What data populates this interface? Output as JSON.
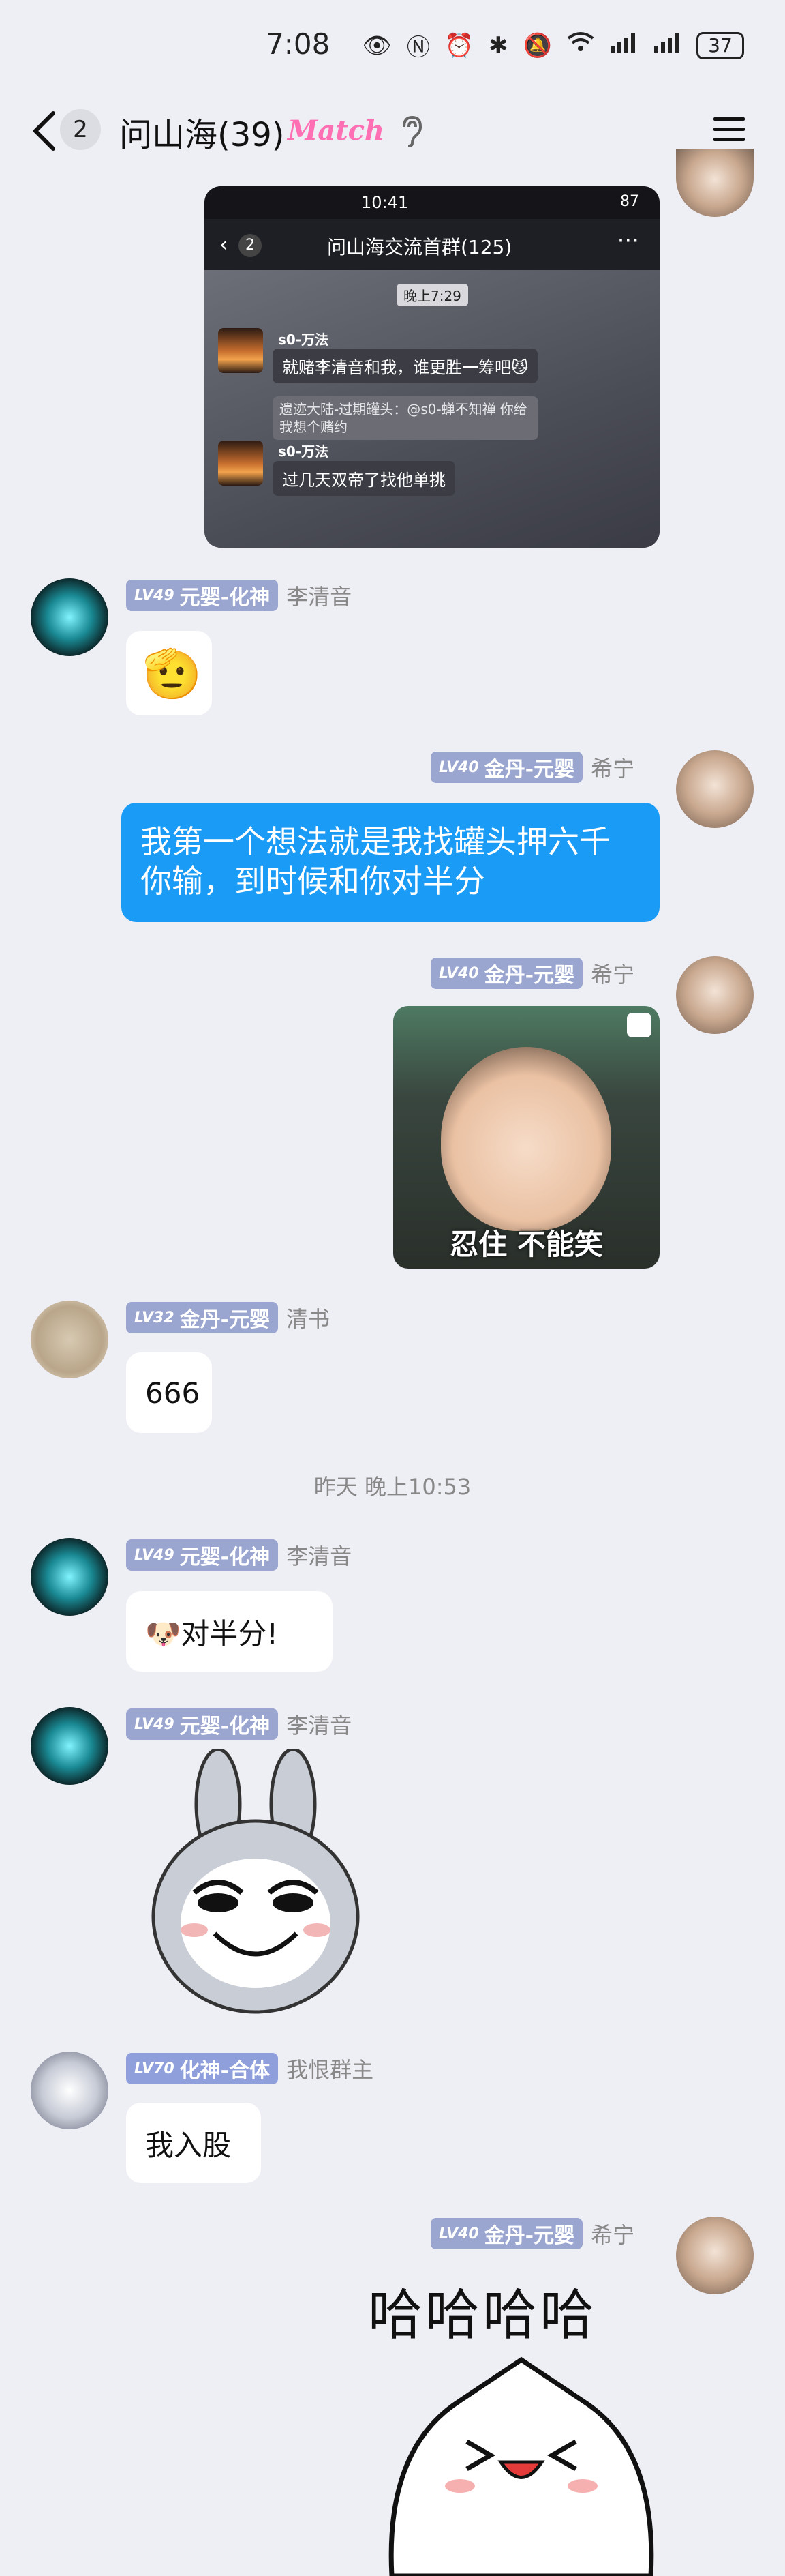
{
  "status_bar": {
    "time": "7:08",
    "icons": [
      "eye-icon",
      "nfc-icon",
      "alarm-icon",
      "bluetooth-icon",
      "mute-icon",
      "wifi-icon",
      "signal-4g-icon",
      "signal-5g-icon"
    ],
    "battery": "37"
  },
  "nav": {
    "unread_count": "2",
    "title": "问山海(39)",
    "match_label": "Match"
  },
  "quoted_screenshot": {
    "time": "10:41",
    "battery": "87",
    "unread_count": "2",
    "group_title": "问山海交流首群(125)",
    "timestamp": "晚上7:29",
    "msg1_name": "s0-万法",
    "msg1_text": "就赌李清音和我，谁更胜一筹吧😼",
    "msg2_quote": "遗迹大陆-过期罐头：@s0-蝉不知禅 你给我想个赌约",
    "msg3_name": "s0-万法",
    "msg3_text": "过几天双帝了找他单挑"
  },
  "messages": [
    {
      "level": "LV49",
      "rank": "元婴-化神",
      "name": "李清音",
      "type": "emoji",
      "content": "🫡"
    },
    {
      "level": "LV40",
      "rank": "金丹-元婴",
      "name": "希宁",
      "type": "text",
      "content_line1": "我第一个想法就是我找罐头押六千",
      "content_line2": "你输，到时候和你对半分"
    },
    {
      "level": "LV40",
      "rank": "金丹-元婴",
      "name": "希宁",
      "type": "image",
      "caption": "忍住 不能笑"
    },
    {
      "level": "LV32",
      "rank": "金丹-元婴",
      "name": "清书",
      "type": "text",
      "content": "666"
    },
    {
      "level": "LV49",
      "rank": "元婴-化神",
      "name": "李清音",
      "type": "text",
      "content": "🐶对半分!"
    },
    {
      "level": "LV49",
      "rank": "元婴-化神",
      "name": "李清音",
      "type": "sticker"
    },
    {
      "level": "LV70",
      "rank": "化神-合体",
      "name": "我恨群主",
      "type": "text",
      "content": "我入股"
    },
    {
      "level": "LV40",
      "rank": "金丹-元婴",
      "name": "希宁",
      "type": "sticker",
      "sticker_text": "哈哈哈哈"
    }
  ],
  "timestamp_divider": "昨天 晚上10:53",
  "colors": {
    "background": "#eeeef5",
    "my_bubble": "#1a9bf5",
    "level_badge": "#9aa6cf",
    "match_pink": "#ff6fb3"
  }
}
